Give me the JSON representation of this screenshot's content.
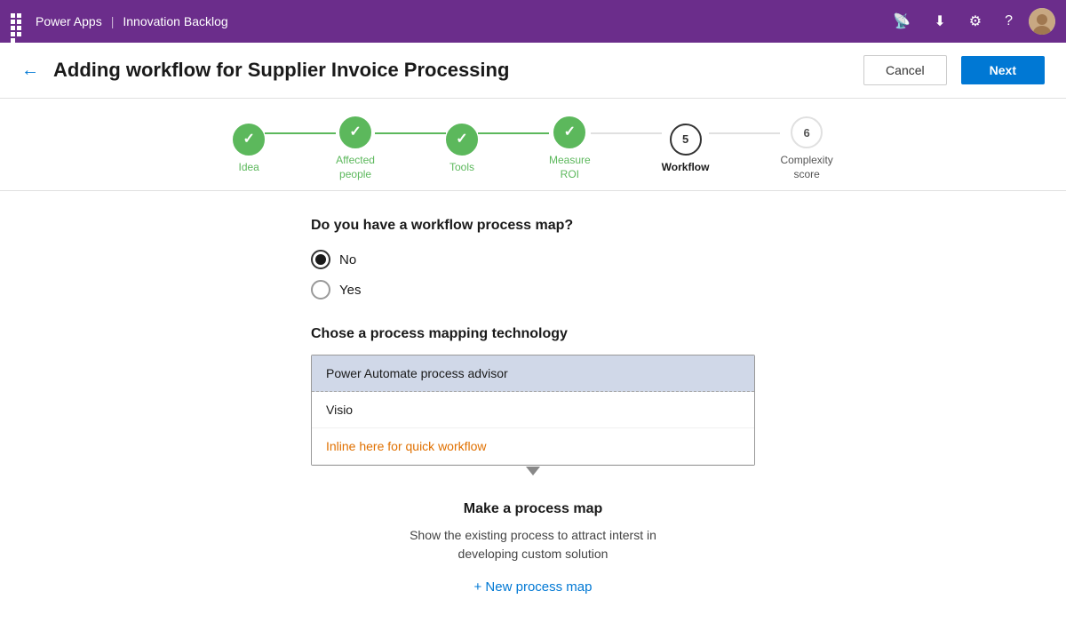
{
  "topbar": {
    "grid_label": "Power Apps",
    "separator": "|",
    "app_name": "Innovation Backlog",
    "icons": [
      "broadcast",
      "download",
      "settings",
      "help"
    ]
  },
  "header": {
    "title": "Adding workflow for Supplier Invoice Processing",
    "cancel_label": "Cancel",
    "next_label": "Next"
  },
  "stepper": {
    "steps": [
      {
        "id": "idea",
        "label": "Idea",
        "state": "done",
        "number": "✓"
      },
      {
        "id": "affected-people",
        "label": "Affected\npeople",
        "state": "done",
        "number": "✓"
      },
      {
        "id": "tools",
        "label": "Tools",
        "state": "done",
        "number": "✓"
      },
      {
        "id": "measure-roi",
        "label": "Measure\nROI",
        "state": "done",
        "number": "✓"
      },
      {
        "id": "workflow",
        "label": "Workflow",
        "state": "active",
        "number": "5"
      },
      {
        "id": "complexity-score",
        "label": "Complexity\nscore",
        "state": "upcoming",
        "number": "6"
      }
    ]
  },
  "workflow_question": {
    "title": "Do you have a workflow process map?",
    "options": [
      {
        "id": "no",
        "label": "No",
        "checked": true
      },
      {
        "id": "yes",
        "label": "Yes",
        "checked": false
      }
    ]
  },
  "process_mapping": {
    "title": "Chose a process mapping technology",
    "options": [
      {
        "id": "power-automate",
        "label": "Power Automate process advisor",
        "selected": true
      },
      {
        "id": "visio",
        "label": "Visio",
        "selected": false
      },
      {
        "id": "inline",
        "label": "Inline here for quick workflow",
        "selected": false,
        "style": "link"
      }
    ]
  },
  "process_map_section": {
    "title": "Make a process map",
    "description": "Show the existing process to attract interst in\ndeveloping custom solution",
    "new_button_label": "+ New process map"
  }
}
